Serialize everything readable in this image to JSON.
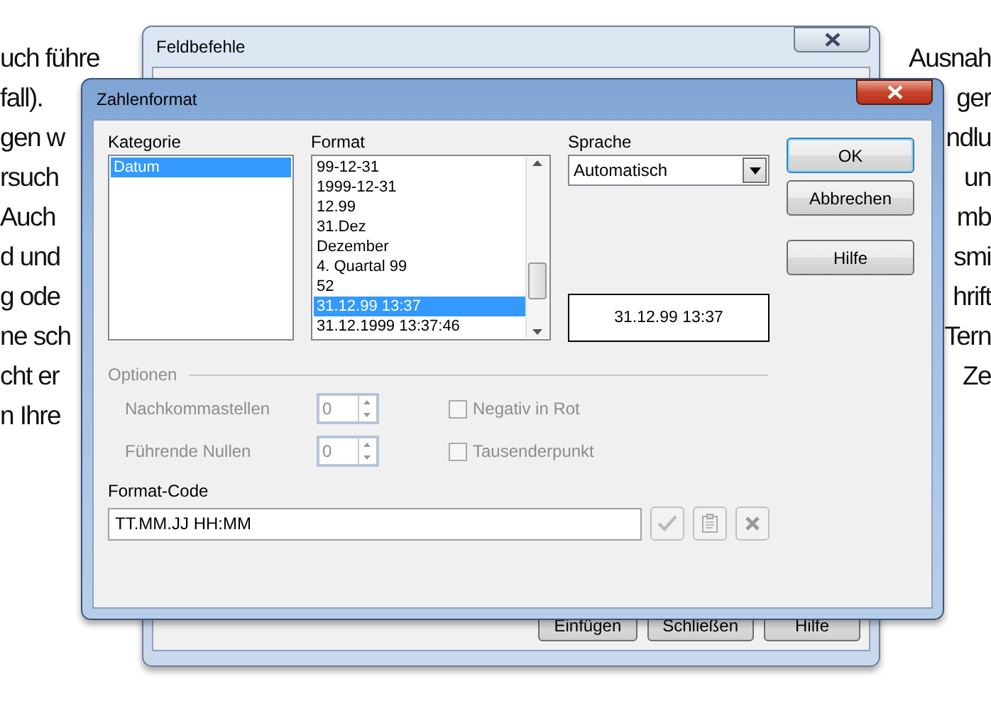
{
  "document": {
    "rows": [
      {
        "left": "uch führe",
        "right": "Ausnah"
      },
      {
        "left": "fall).",
        "right": "ger"
      },
      {
        "left": "gen w",
        "right": "ndlu"
      },
      {
        "left": "rsuch",
        "right": "un"
      },
      {
        "left": "Auch",
        "right": "mb"
      },
      {
        "left": "d und",
        "right": "smi"
      },
      {
        "left": "g ode",
        "right": "hrift"
      },
      {
        "left": "ne sch",
        "right": "Tern"
      },
      {
        "left": "cht er",
        "right": "Ze"
      },
      {
        "left": "n Ihre",
        "right": ""
      }
    ]
  },
  "back_window": {
    "title": "Feldbefehle",
    "buttons": [
      {
        "label": "Einfügen"
      },
      {
        "label": "Schließen"
      },
      {
        "label": "Hilfe"
      }
    ]
  },
  "dialog": {
    "title": "Zahlenformat",
    "category": {
      "label": "Kategorie",
      "items": [
        {
          "label": "Datum",
          "selected": true
        }
      ]
    },
    "format": {
      "label": "Format",
      "items": [
        {
          "label": "99-12-31",
          "selected": false
        },
        {
          "label": "1999-12-31",
          "selected": false
        },
        {
          "label": "12.99",
          "selected": false
        },
        {
          "label": "31.Dez",
          "selected": false
        },
        {
          "label": "Dezember",
          "selected": false
        },
        {
          "label": "4. Quartal 99",
          "selected": false
        },
        {
          "label": "52",
          "selected": false
        },
        {
          "label": "31.12.99 13:37",
          "selected": true
        },
        {
          "label": "31.12.1999 13:37:46",
          "selected": false
        }
      ]
    },
    "language": {
      "label": "Sprache",
      "value": "Automatisch"
    },
    "preview": "31.12.99 13:37",
    "buttons": [
      {
        "label": "OK",
        "default": true
      },
      {
        "label": "Abbrechen",
        "default": false
      },
      {
        "label": "Hilfe",
        "default": false
      }
    ],
    "options": {
      "title": "Optionen",
      "disabled": true,
      "spinners": [
        {
          "label": "Nachkommastellen",
          "value": "0"
        },
        {
          "label": "Führende Nullen",
          "value": "0"
        }
      ],
      "checkboxes": [
        {
          "label": "Negativ in Rot",
          "checked": false
        },
        {
          "label": "Tausenderpunkt",
          "checked": false
        }
      ]
    },
    "format_code": {
      "label": "Format-Code",
      "value": "TT.MM.JJ HH:MM"
    }
  }
}
